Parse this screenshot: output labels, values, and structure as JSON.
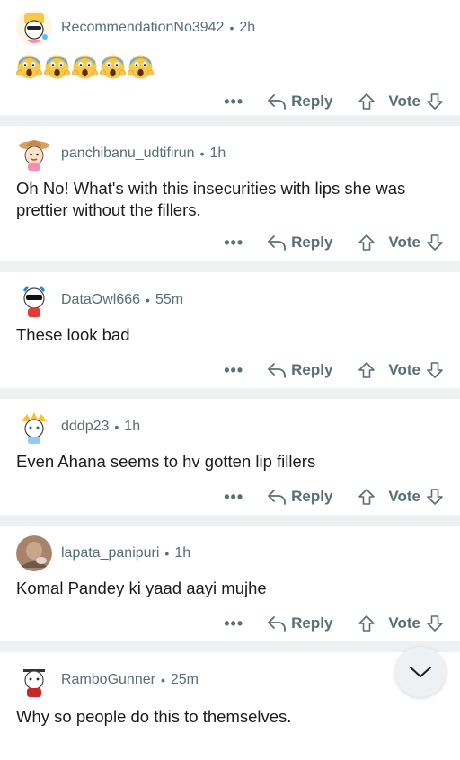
{
  "actions": {
    "more_label": "•••",
    "reply_label": "Reply",
    "vote_label": "Vote"
  },
  "colors": {
    "meta": "#576f76",
    "text": "#1c1c1c",
    "separator": "#eef0f2"
  },
  "comments": [
    {
      "username": "RecommendationNo3942",
      "time": "2h",
      "emoji": [
        "😱",
        "😱",
        "😱",
        "😱",
        "😱"
      ]
    },
    {
      "username": "panchibanu_udtifirun",
      "time": "1h",
      "text": "Oh No! What's with this insecurities with lips she was prettier without the fillers."
    },
    {
      "username": "DataOwl666",
      "time": "55m",
      "text": "These look bad"
    },
    {
      "username": "dddp23",
      "time": "1h",
      "text": "Even Ahana seems to hv gotten lip fillers"
    },
    {
      "username": "lapata_panipuri",
      "time": "1h",
      "text": "Komal Pandey ki yaad aayi mujhe"
    },
    {
      "username": "RamboGunner",
      "time": "25m",
      "text": "Why so people do this to themselves."
    }
  ],
  "scroll_button": {
    "icon": "chevron-down-icon"
  }
}
